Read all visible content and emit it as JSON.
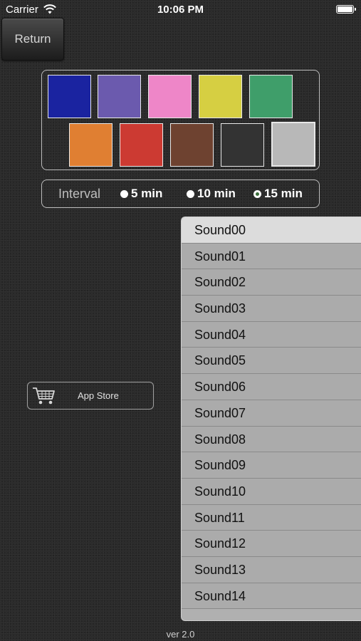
{
  "status_bar": {
    "carrier": "Carrier",
    "time": "10:06 PM"
  },
  "return_button": {
    "label": "Return"
  },
  "palette": {
    "colors": [
      "#1a23a0",
      "#6b5aae",
      "#ee86c8",
      "#d6cf42",
      "#3f9e6a",
      "#e07f32",
      "#cc3a32",
      "#6e4230",
      "#333333",
      "#b8b8b8"
    ],
    "selected_index": 9
  },
  "interval": {
    "label": "Interval",
    "options": [
      "5 min",
      "10 min",
      "15 min"
    ],
    "selected": "15 min"
  },
  "app_store": {
    "label": "App Store",
    "icon": "cart-icon"
  },
  "sounds": {
    "items": [
      "Sound00",
      "Sound01",
      "Sound02",
      "Sound03",
      "Sound04",
      "Sound05",
      "Sound06",
      "Sound07",
      "Sound08",
      "Sound09",
      "Sound10",
      "Sound11",
      "Sound12",
      "Sound13",
      "Sound14"
    ],
    "selected": "Sound00"
  },
  "version": "ver 2.0"
}
